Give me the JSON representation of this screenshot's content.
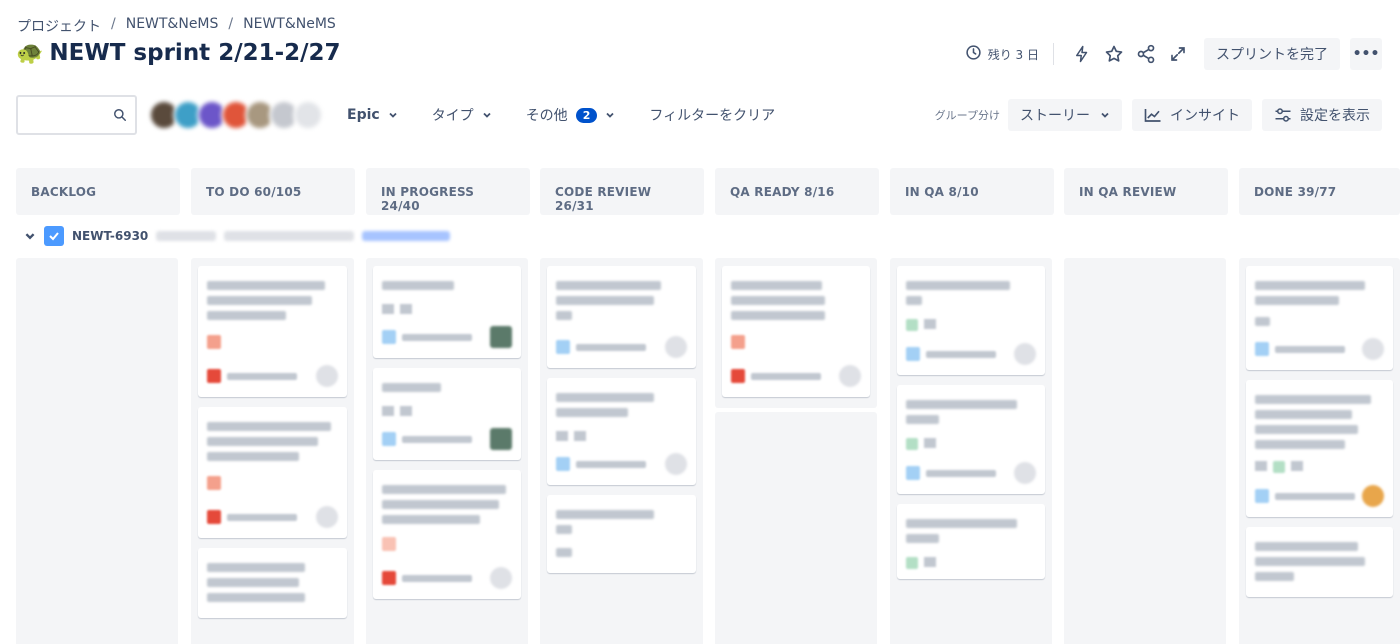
{
  "breadcrumb": {
    "project": "プロジェクト",
    "item1": "NEWT&NeMS",
    "item2": "NEWT&NeMS",
    "separator": "/"
  },
  "title": {
    "emoji": "🐢",
    "text": "NEWT sprint 2/21-2/27"
  },
  "header": {
    "days_left": "残り 3 日",
    "complete_sprint": "スプリントを完了",
    "more": "•••"
  },
  "toolbar": {
    "search_placeholder": "",
    "epic": "Epic",
    "type": "タイプ",
    "other": "その他",
    "other_count": "2",
    "clear_filters": "フィルターをクリア",
    "group_label": "グループ分け",
    "group_value": "ストーリー",
    "insight": "インサイト",
    "settings": "設定を表示"
  },
  "columns": [
    {
      "name": "BACKLOG"
    },
    {
      "name": "TO DO 60/105"
    },
    {
      "name": "IN PROGRESS 24/40"
    },
    {
      "name": "CODE REVIEW 26/31"
    },
    {
      "name": "QA READY 8/16"
    },
    {
      "name": "IN QA 8/10"
    },
    {
      "name": "IN QA REVIEW"
    },
    {
      "name": "DONE 39/77"
    }
  ],
  "swimlane": {
    "key": "NEWT-6930"
  },
  "colors": {
    "accent": "#0052cc",
    "checkbox": "#4c9aff",
    "bug": "#e5493a",
    "story": "#4bade8",
    "task_green": "#b3dfc5"
  },
  "icons": [
    "clock-icon",
    "lightning-icon",
    "star-icon",
    "share-icon",
    "expand-icon",
    "search-icon",
    "chevron-down-icon",
    "insight-icon",
    "settings-icon"
  ]
}
